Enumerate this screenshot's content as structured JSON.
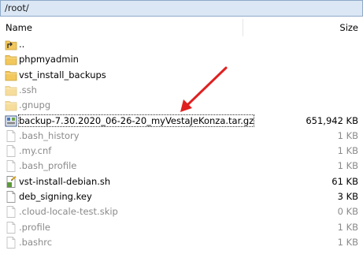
{
  "path": "/root/",
  "columns": {
    "name": "Name",
    "size": "Size"
  },
  "files": [
    {
      "name": "..",
      "size": "",
      "icon": "folder-up-icon",
      "hidden": false
    },
    {
      "name": "phpmyadmin",
      "size": "",
      "icon": "folder-icon",
      "hidden": false
    },
    {
      "name": "vst_install_backups",
      "size": "",
      "icon": "folder-icon",
      "hidden": false
    },
    {
      "name": ".ssh",
      "size": "",
      "icon": "folder-icon",
      "hidden": true
    },
    {
      "name": ".gnupg",
      "size": "",
      "icon": "folder-icon",
      "hidden": true
    },
    {
      "name": "backup-7.30.2020_06-26-20_myVestaJeKonza.tar.gz",
      "size": "651,942 KB",
      "icon": "archive-icon",
      "hidden": false,
      "selected": true
    },
    {
      "name": ".bash_history",
      "size": "1 KB",
      "icon": "file-icon",
      "hidden": true
    },
    {
      "name": ".my.cnf",
      "size": "1 KB",
      "icon": "file-icon",
      "hidden": true
    },
    {
      "name": ".bash_profile",
      "size": "1 KB",
      "icon": "file-icon",
      "hidden": true
    },
    {
      "name": "vst-install-debian.sh",
      "size": "61 KB",
      "icon": "script-icon",
      "hidden": false
    },
    {
      "name": "deb_signing.key",
      "size": "3 KB",
      "icon": "file-icon",
      "hidden": false
    },
    {
      "name": ".cloud-locale-test.skip",
      "size": "0 KB",
      "icon": "file-icon",
      "hidden": true
    },
    {
      "name": ".profile",
      "size": "1 KB",
      "icon": "file-icon",
      "hidden": true
    },
    {
      "name": ".bashrc",
      "size": "1 KB",
      "icon": "file-icon",
      "hidden": true
    }
  ],
  "colors": {
    "annotation_arrow": "#e02020",
    "folder": "#f2c75c",
    "pathbar_bg": "#dbe7f5"
  }
}
